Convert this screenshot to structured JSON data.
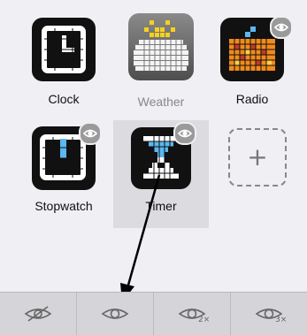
{
  "apps": [
    {
      "label": "Clock",
      "icon": "clock-icon"
    },
    {
      "label": "Weather",
      "icon": "weather-icon"
    },
    {
      "label": "Radio",
      "icon": "radio-icon"
    },
    {
      "label": "Stopwatch",
      "icon": "stopwatch-icon"
    },
    {
      "label": "Timer",
      "icon": "timer-icon"
    }
  ],
  "add_tile": {
    "symbol": "+"
  },
  "toolbar": {
    "buttons": [
      {
        "icon": "eye-hidden-icon",
        "sub": ""
      },
      {
        "icon": "eye-icon",
        "sub": ""
      },
      {
        "icon": "eye-2x-icon",
        "sub": "2×"
      },
      {
        "icon": "eye-3x-icon",
        "sub": "3×"
      }
    ]
  },
  "colors": {
    "background": "#efeff4",
    "toolbar": "#d5d5d9",
    "selected_tile": "#dcdce0",
    "timer_accent": "#5bb8f0",
    "weather_sun": "#f5d21b",
    "radio_orange": "#f28a1c"
  }
}
